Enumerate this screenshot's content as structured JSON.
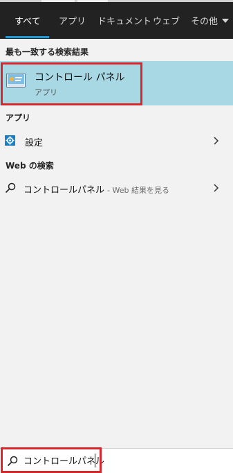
{
  "tabs": [
    {
      "label": "すべて",
      "active": true
    },
    {
      "label": "アプリ",
      "active": false
    },
    {
      "label": "ドキュメント",
      "active": false
    },
    {
      "label": "ウェブ",
      "active": false
    },
    {
      "label": "その他",
      "active": false
    }
  ],
  "best_match": {
    "header": "最も一致する検索結果",
    "title": "コントロール パネル",
    "subtitle": "アプリ",
    "icon": "control-panel-icon"
  },
  "apps": {
    "header": "アプリ",
    "items": [
      {
        "label": "設定",
        "icon": "settings-gear-icon"
      }
    ]
  },
  "web": {
    "header": "Web の検索",
    "items": [
      {
        "label": "コントロールパネル",
        "hint": "- Web 結果を見る",
        "icon": "search-icon"
      }
    ]
  },
  "search": {
    "value": "コントロールパネル",
    "icon": "search-icon"
  },
  "colors": {
    "accent": "#1c9bd6",
    "highlight": "#a8d8e4",
    "annotation": "#d9262b",
    "tabbar": "#222222"
  }
}
